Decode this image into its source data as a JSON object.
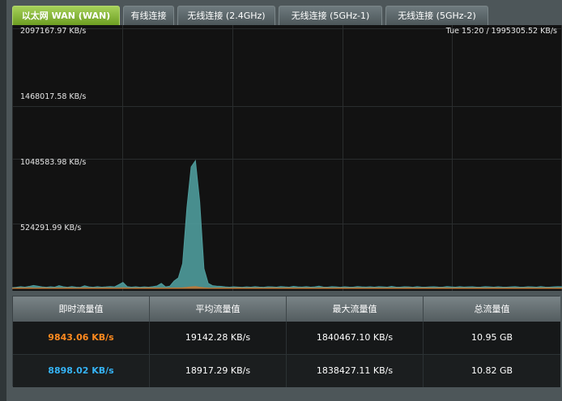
{
  "tabs": [
    {
      "label": "以太网 WAN (WAN)",
      "active": true
    },
    {
      "label": "有线连接",
      "active": false
    },
    {
      "label": "无线连接 (2.4GHz)",
      "active": false
    },
    {
      "label": "无线连接 (5GHz-1)",
      "active": false
    },
    {
      "label": "无线连接 (5GHz-2)",
      "active": false
    }
  ],
  "chart_data": {
    "type": "area",
    "y_tick_labels": [
      "2097167.97 KB/s",
      "1468017.58 KB/s",
      "1048583.98 KB/s",
      "524291.99 KB/s"
    ],
    "y_ticks": [
      2097167.97,
      1468017.58,
      1048583.98,
      524291.99
    ],
    "ylim": [
      0,
      2097167.97
    ],
    "status": "Tue 15:20 / 1995305.52 KB/s",
    "grid": true,
    "series": [
      {
        "color": "#4f9c9c",
        "values": [
          6000,
          9000,
          14000,
          10000,
          16000,
          24000,
          18000,
          12000,
          9000,
          13000,
          10000,
          22000,
          13000,
          9000,
          15000,
          10000,
          8000,
          21000,
          12000,
          9000,
          14000,
          10000,
          12000,
          15000,
          12000,
          30000,
          48000,
          14000,
          10000,
          13000,
          9000,
          12000,
          10000,
          14000,
          20000,
          40000,
          12000,
          18000,
          60000,
          85000,
          200000,
          650000,
          980000,
          1030000,
          700000,
          160000,
          40000,
          22000,
          18000,
          16000,
          12000,
          10000,
          13000,
          11000,
          9000,
          12000,
          10000,
          14000,
          11000,
          9000,
          13000,
          12000,
          10000,
          15000,
          12000,
          10000,
          16000,
          12000,
          11000,
          14000,
          10000,
          12000,
          18000,
          11000,
          10000,
          14000,
          12000,
          9000,
          13000,
          11000,
          10000,
          15000,
          12000,
          11000,
          13000,
          10000,
          14000,
          12000,
          10000,
          16000,
          11000,
          10000,
          13000,
          12000,
          9000,
          14000,
          11000,
          10000,
          12000,
          13000,
          11000,
          10000,
          15000,
          12000,
          10000,
          14000,
          11000,
          12000,
          13000,
          10000,
          11000,
          14000,
          12000,
          10000,
          13000,
          11000,
          10000,
          12000,
          14000,
          11000,
          10000,
          13000,
          12000,
          10000,
          15000,
          11000,
          10000,
          12000,
          14000,
          13000
        ]
      },
      {
        "color": "#c07a3a",
        "values": [
          2000,
          3000,
          4000,
          3000,
          5000,
          3000,
          2500,
          4000,
          3000,
          2000,
          3500,
          3000,
          2500,
          4000,
          3000,
          2000,
          3000,
          4000,
          3500,
          3000,
          2500,
          3000,
          4000,
          3000,
          2500,
          3500,
          4000,
          3000,
          2000,
          3000,
          2500,
          3000,
          4000,
          3500,
          3000,
          3000,
          2500,
          3000,
          3500,
          4000,
          5000,
          8000,
          12000,
          15000,
          9000,
          5000,
          3000,
          2500,
          3000,
          3500,
          3000,
          2500,
          3000,
          4000,
          3000,
          2500,
          3000,
          3500,
          3000,
          2500,
          3000,
          4000,
          3000,
          2500,
          3500,
          3000,
          3000,
          2500,
          3000,
          3500,
          3000,
          2500,
          3000,
          4000,
          3000,
          2500,
          3000,
          3500,
          3000,
          2500,
          3000,
          4000,
          3000,
          2500,
          3500,
          3000,
          3000,
          2500,
          3000,
          3500,
          3000,
          2500,
          3000,
          4000,
          3000,
          2500,
          3000,
          3500,
          3000,
          2500,
          3000,
          4000,
          3000,
          2500,
          3500,
          3000,
          3000,
          2500,
          3000,
          3500,
          3000,
          2500,
          3000,
          4000,
          3000,
          2500,
          3000,
          3500,
          3000,
          2500,
          3000,
          4000,
          3000,
          2500,
          3500,
          3000,
          3000,
          2500,
          3000,
          3500
        ]
      }
    ]
  },
  "table": {
    "headers": [
      "即时流量值",
      "平均流量值",
      "最大流量值",
      "总流量值"
    ],
    "rows": [
      {
        "current": "9843.06 KB/s",
        "current_color": "#ff8a1f",
        "average": "19142.28 KB/s",
        "max": "1840467.10 KB/s",
        "total": "10.95 GB"
      },
      {
        "current": "8898.02 KB/s",
        "current_color": "#35b3f5",
        "average": "18917.29 KB/s",
        "max": "1838427.11 KB/s",
        "total": "10.82 GB"
      }
    ]
  }
}
